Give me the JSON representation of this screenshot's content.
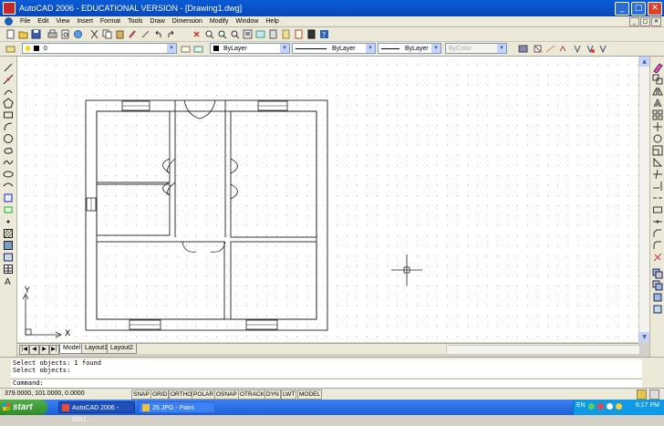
{
  "window": {
    "title": "AutoCAD 2006 - EDUCATIONAL VERSION - [Drawing1.dwg]",
    "buttons": {
      "minimize": "_",
      "maximize": "□",
      "close": "✕"
    }
  },
  "menubar": {
    "items": [
      "File",
      "Edit",
      "View",
      "Insert",
      "Format",
      "Tools",
      "Draw",
      "Dimension",
      "Modify",
      "Window",
      "Help"
    ]
  },
  "layers_toolbar": {
    "layer_value": "0",
    "color_value": "ByLayer",
    "linetype_value": "ByLayer",
    "lineweight_value": "ByLayer",
    "plotstyle_value": "ByColor"
  },
  "canvas": {
    "ucs_x_label": "X",
    "ucs_y_label": "Y"
  },
  "layout_tabs": [
    "Model",
    "Layout1",
    "Layout2"
  ],
  "nav_buttons": [
    "|◀",
    "◀",
    "▶",
    "▶|"
  ],
  "command": {
    "history": [
      "Select objects: 1 found",
      "Select objects:"
    ],
    "prompt": "Command:"
  },
  "status": {
    "coordinates": "379.0000, 101.0000, 0.0000",
    "toggles": [
      "SNAP",
      "GRID",
      "ORTHO",
      "POLAR",
      "OSNAP",
      "OTRACK",
      "DYN",
      "LWT",
      "MODEL"
    ]
  },
  "taskbar": {
    "start_label": "start",
    "tasks": [
      {
        "label": "AutoCAD 2006 - EDU...",
        "active": true
      },
      {
        "label": "25.JPG - Paint",
        "active": false
      }
    ],
    "language": "EN",
    "clock": "6:17 PM"
  },
  "colors": {
    "titlebar": "#0a5bd6",
    "canvas": "#ffffff",
    "grid_dot": "#b5b5b5",
    "taskbar": "#1f5fd6",
    "start_button": "#3f9e3a"
  }
}
